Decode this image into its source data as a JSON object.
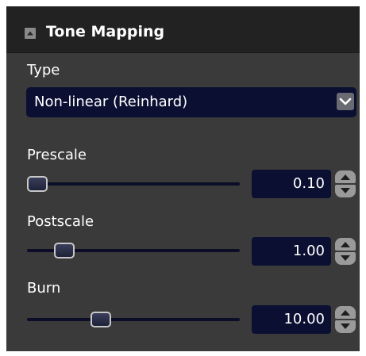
{
  "section": {
    "title": "Tone Mapping",
    "collapse_icon": "triangle-up-icon"
  },
  "type_field": {
    "label": "Type",
    "value": "Non-linear (Reinhard)",
    "arrow_icon": "chevron-down-icon"
  },
  "sliders": [
    {
      "label": "Prescale",
      "value": "0.10",
      "position": 0.0
    },
    {
      "label": "Postscale",
      "value": "1.00",
      "position": 0.14
    },
    {
      "label": "Burn",
      "value": "10.00",
      "position": 0.33
    }
  ],
  "spinner_icons": {
    "up": "triangle-up-icon",
    "down": "triangle-down-icon"
  },
  "colors": {
    "panel": "#3a3a3a",
    "header": "#222222",
    "field": "#0b1033",
    "text": "#ffffff"
  }
}
